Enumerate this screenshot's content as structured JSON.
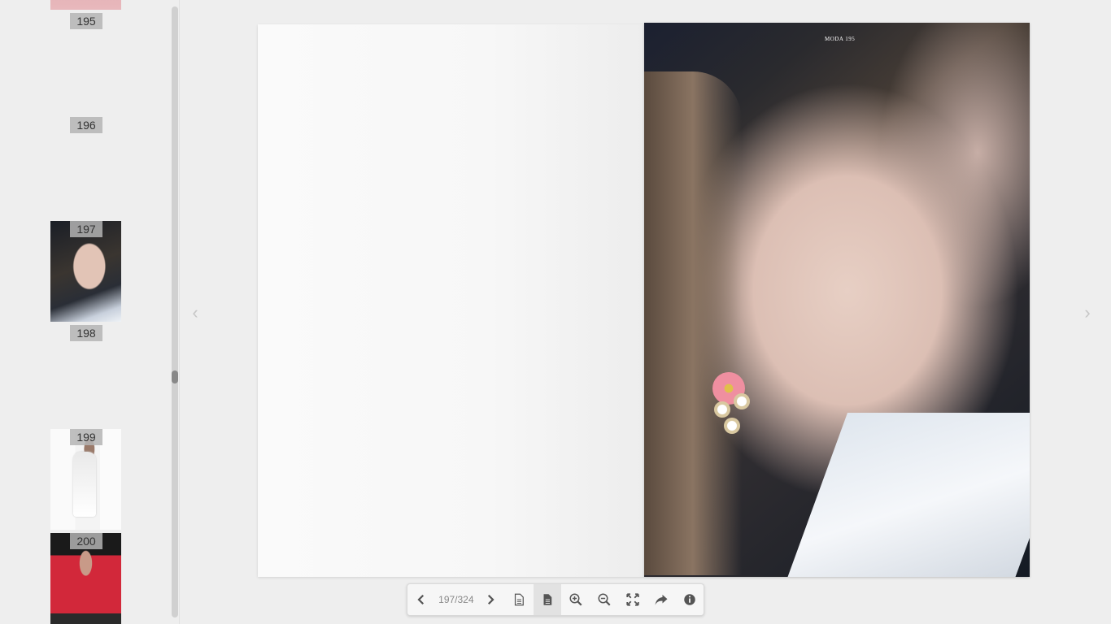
{
  "sidebar": {
    "thumbnails": [
      {
        "label": "195"
      },
      {
        "label": "196"
      },
      {
        "label": "197"
      },
      {
        "label": "198"
      },
      {
        "label": "199"
      },
      {
        "label": "200"
      }
    ]
  },
  "reader": {
    "right_page_header": "MODA 195",
    "prev_arrow": "‹",
    "next_arrow": "›"
  },
  "toolbar": {
    "page_counter": "197/324",
    "icons": [
      "chevron-left-icon",
      "chevron-right-icon",
      "single-page-icon",
      "double-page-icon",
      "zoom-in-icon",
      "zoom-out-icon",
      "fullscreen-icon",
      "share-icon",
      "info-icon"
    ]
  },
  "colors": {
    "background": "#eeeeee",
    "toolbar_bg": "#f6f6f6",
    "label_bg": "#b4b4b4"
  }
}
